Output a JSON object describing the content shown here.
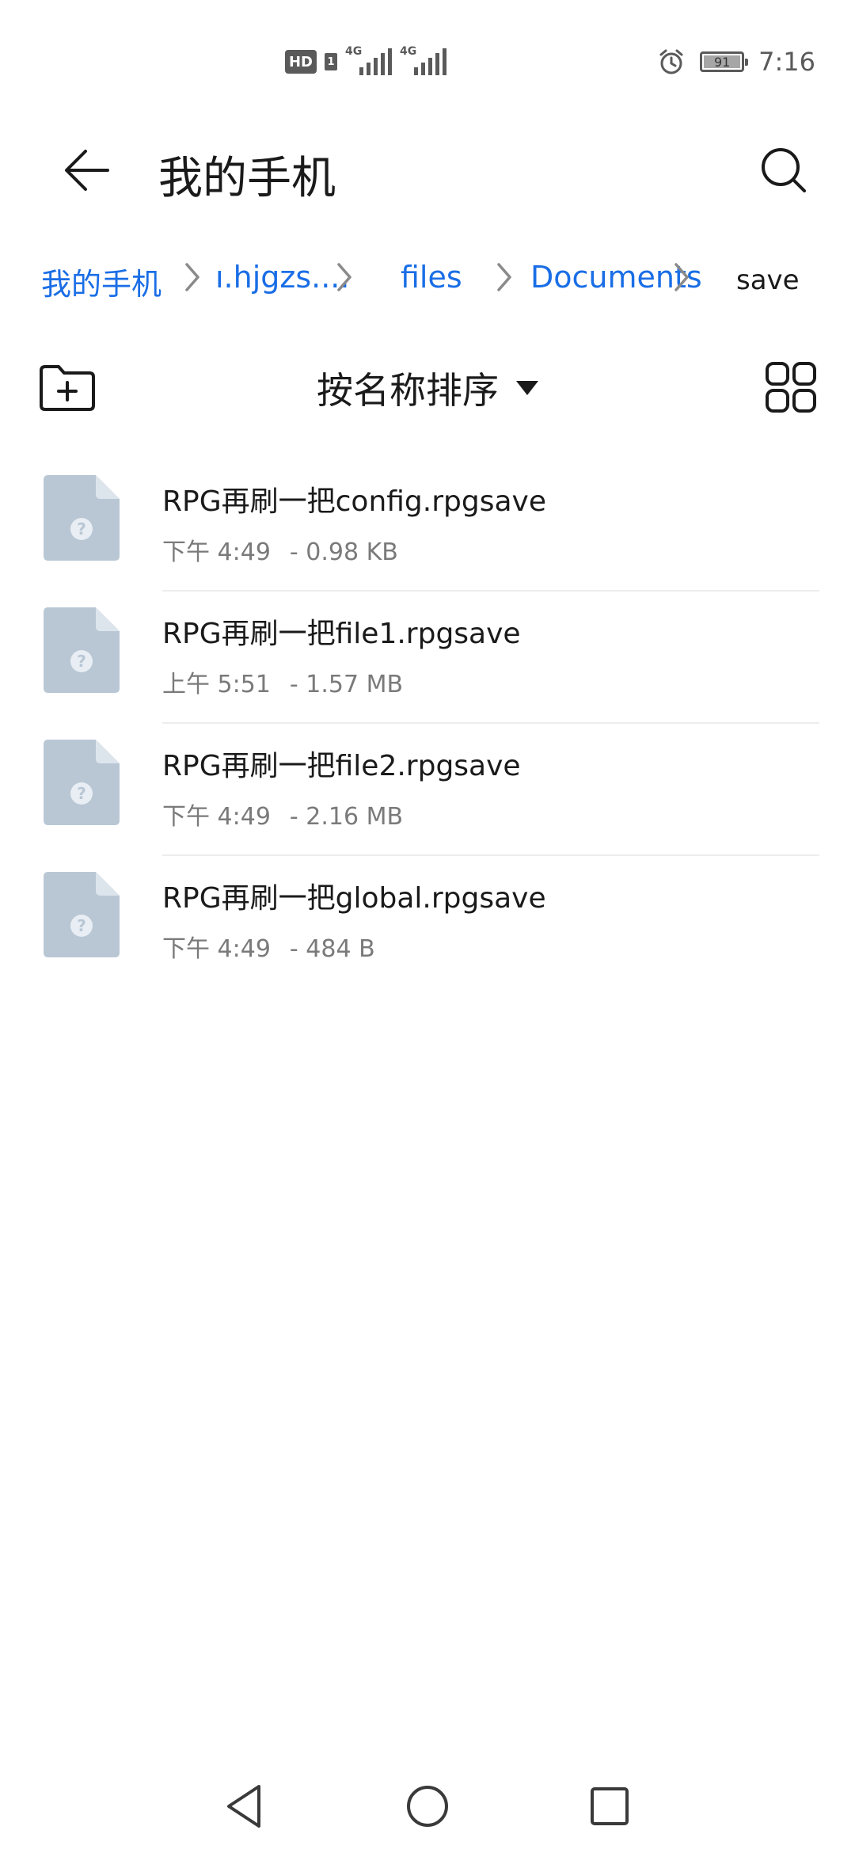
{
  "status_bar": {
    "hd_badge": "HD",
    "sim_badge": "1",
    "network_1": "4G",
    "network_2": "4G",
    "battery_level": "91",
    "time": "7:16"
  },
  "header": {
    "title": "我的手机",
    "back_icon": "back-arrow-icon",
    "search_icon": "search-icon"
  },
  "breadcrumb": {
    "items": [
      {
        "label": "我的手机"
      },
      {
        "label": "ı.hjgzs...."
      },
      {
        "label": "files"
      },
      {
        "label": "Documents"
      },
      {
        "label": "save"
      }
    ]
  },
  "toolbar": {
    "sort_label": "按名称排序",
    "new_folder_icon": "new-folder-icon",
    "grid_view_icon": "grid-view-icon"
  },
  "files": [
    {
      "name": "RPG再刷一把config.rpgsave",
      "time": "下午 4:49",
      "size": "- 0.98 KB"
    },
    {
      "name": "RPG再刷一把file1.rpgsave",
      "time": "上午 5:51",
      "size": "- 1.57 MB"
    },
    {
      "name": "RPG再刷一把file2.rpgsave",
      "time": "下午 4:49",
      "size": "- 2.16 MB"
    },
    {
      "name": "RPG再刷一把global.rpgsave",
      "time": "下午 4:49",
      "size": "- 484 B"
    }
  ],
  "colors": {
    "accent": "#1a6ee6",
    "file_icon": "#b9c7d5",
    "secondary_text": "#7a7a7a"
  }
}
